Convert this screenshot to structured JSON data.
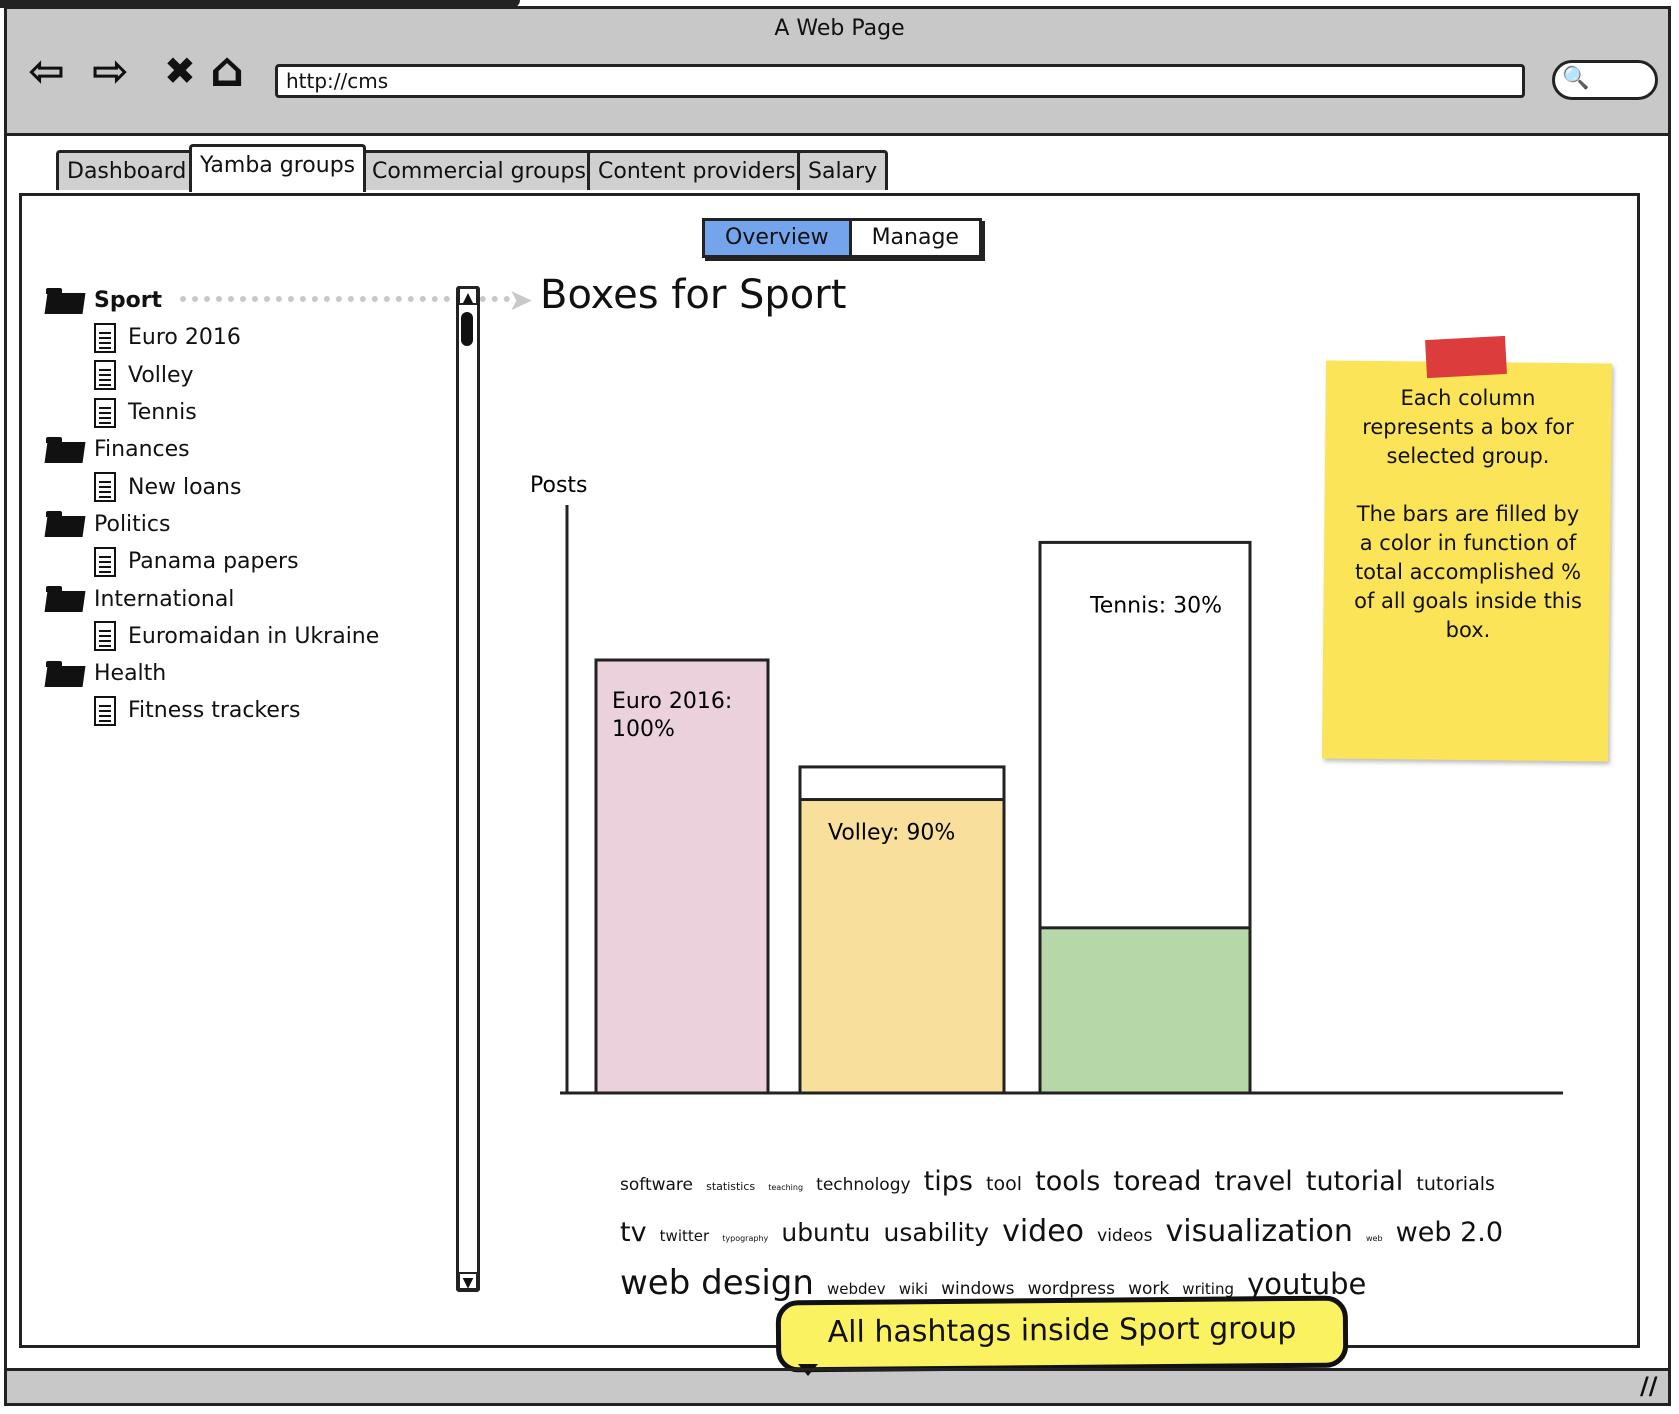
{
  "window": {
    "title": "A Web Page"
  },
  "toolbar": {
    "back_icon": "⇦",
    "forward_icon": "⇨",
    "stop_icon": "✖",
    "home_icon": "⌂",
    "url": "http://cms",
    "search_icon": "🔍"
  },
  "tabs": [
    {
      "label": "Dashboard"
    },
    {
      "label": "Yamba groups",
      "active": true
    },
    {
      "label": "Commercial groups"
    },
    {
      "label": "Content providers"
    },
    {
      "label": "Salary"
    }
  ],
  "view_toggle": {
    "overview": "Overview",
    "manage": "Manage",
    "selected": "Overview"
  },
  "tree": [
    {
      "type": "folder",
      "label": "Sport",
      "bold": true
    },
    {
      "type": "doc",
      "label": "Euro 2016"
    },
    {
      "type": "doc",
      "label": "Volley"
    },
    {
      "type": "doc",
      "label": "Tennis"
    },
    {
      "type": "folder",
      "label": "Finances"
    },
    {
      "type": "doc",
      "label": "New loans"
    },
    {
      "type": "folder",
      "label": "Politics"
    },
    {
      "type": "doc",
      "label": "Panama papers"
    },
    {
      "type": "folder",
      "label": "International"
    },
    {
      "type": "doc",
      "label": "Euromaidan in Ukraine"
    },
    {
      "type": "folder",
      "label": "Health"
    },
    {
      "type": "doc",
      "label": "Fitness trackers"
    }
  ],
  "page_title": "Boxes for Sport",
  "chart_data": {
    "type": "bar",
    "ylabel": "Posts",
    "categories": [
      "Euro 2016",
      "Volley",
      "Tennis"
    ],
    "values": [
      81,
      61,
      103
    ],
    "percent_fill": [
      100,
      90,
      30
    ],
    "labels": [
      "Euro 2016:\n100%",
      "Volley: 90%",
      "Tennis: 30%"
    ],
    "colors": [
      "#ead1dc",
      "#f8e09c",
      "#b6d7a8"
    ],
    "ylim": [
      0,
      110
    ]
  },
  "sticky_note": {
    "text": "Each column\nrepresents a box for\nselected group.\n\nThe bars are filled by\na color in function of\ntotal accomplished %\nof all goals inside this\nbox."
  },
  "tag_cloud": [
    {
      "tag": "software",
      "size": 17
    },
    {
      "tag": "statistics",
      "size": 11
    },
    {
      "tag": "teaching",
      "size": 8
    },
    {
      "tag": "technology",
      "size": 17
    },
    {
      "tag": "tips",
      "size": 27
    },
    {
      "tag": "tool",
      "size": 19
    },
    {
      "tag": "tools",
      "size": 27
    },
    {
      "tag": "toread",
      "size": 27
    },
    {
      "tag": "travel",
      "size": 27
    },
    {
      "tag": "tutorial",
      "size": 27
    },
    {
      "tag": "tutorials",
      "size": 19
    },
    {
      "tag": "tv",
      "size": 27
    },
    {
      "tag": "twitter",
      "size": 15
    },
    {
      "tag": "typography",
      "size": 8
    },
    {
      "tag": "ubuntu",
      "size": 25
    },
    {
      "tag": "usability",
      "size": 25
    },
    {
      "tag": "video",
      "size": 30
    },
    {
      "tag": "videos",
      "size": 17
    },
    {
      "tag": "visualization",
      "size": 30
    },
    {
      "tag": "web",
      "size": 8
    },
    {
      "tag": "web 2.0",
      "size": 27
    },
    {
      "tag": "web design",
      "size": 34
    },
    {
      "tag": "webdev",
      "size": 15
    },
    {
      "tag": "wiki",
      "size": 15
    },
    {
      "tag": "windows",
      "size": 17
    },
    {
      "tag": "wordpress",
      "size": 17
    },
    {
      "tag": "work",
      "size": 17
    },
    {
      "tag": "writing",
      "size": 15
    },
    {
      "tag": "youtube",
      "size": 29
    }
  ],
  "callout": {
    "text": "All hashtags inside Sport group"
  },
  "status": {
    "resize_icon": "//"
  },
  "colors": {
    "accent": "#74a5ec",
    "sticky": "#fbe457",
    "callout": "#fbf261"
  }
}
